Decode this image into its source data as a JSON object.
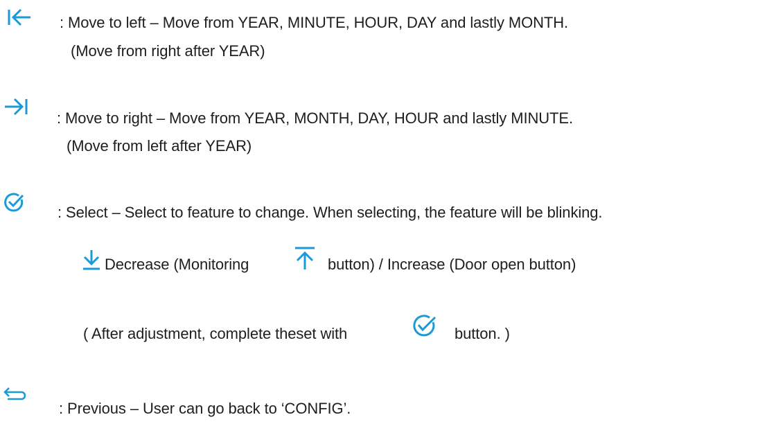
{
  "icon_color": "#1a9ad6",
  "text_color": "#1e1e1e",
  "items": [
    {
      "icon": "move-left-icon",
      "line1": ":  Move to left – Move from YEAR, MINUTE, HOUR, DAY and lastly MONTH.",
      "line2": "(Move from right after YEAR)"
    },
    {
      "icon": "move-right-icon",
      "line1": ": Move to right – Move from YEAR, MONTH, DAY, HOUR and lastly MINUTE.",
      "line2": "(Move from left after YEAR)"
    },
    {
      "icon": "select-check-icon",
      "line1": ": Select – Select to feature to change. When selecting, the feature will be blinking."
    },
    {
      "icon": "previous-back-icon",
      "line1": ": Previous – User can go back to ‘CONFIG’."
    }
  ],
  "adjust": {
    "decrease_icon": "arrow-down-icon",
    "increase_icon": "arrow-up-icon",
    "text_a": "Decrease (Monitoring",
    "text_b": "button) / Increase (Door open button)"
  },
  "complete": {
    "icon": "select-check-icon",
    "text_a": "( After adjustment, complete theset with",
    "text_b": "button. )"
  }
}
